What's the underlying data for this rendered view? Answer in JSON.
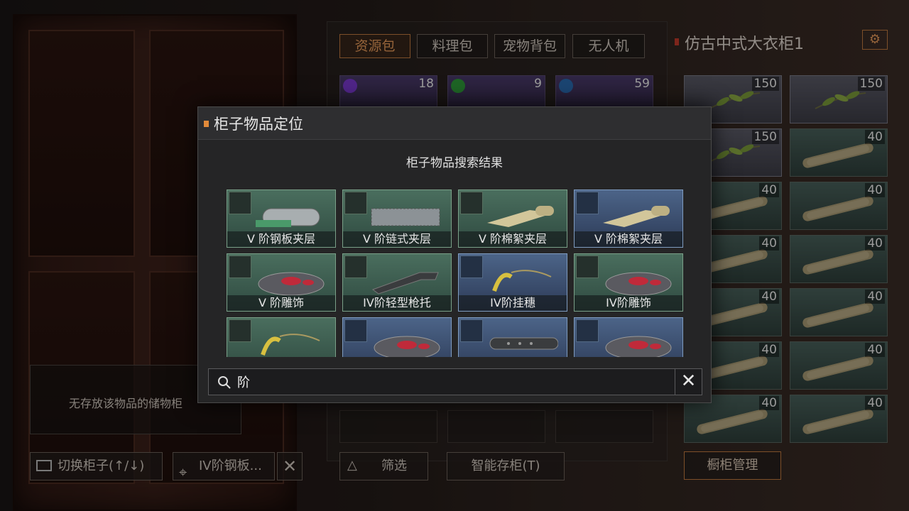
{
  "storage_tabs": [
    {
      "label": "资源包",
      "active": true
    },
    {
      "label": "料理包",
      "active": false
    },
    {
      "label": "宠物背包",
      "active": false
    },
    {
      "label": "无人机",
      "active": false
    }
  ],
  "bag_items": [
    {
      "count": "18",
      "badge_color": "#7a3ad0"
    },
    {
      "count": "9",
      "badge_color": "#2e9a3a"
    },
    {
      "count": "59",
      "badge_color": "#2a6ab0"
    }
  ],
  "cabinet": {
    "title": "仿古中式大衣柜1",
    "gear_icon": "gear-icon",
    "slots": [
      {
        "count": "150",
        "type": "leaf"
      },
      {
        "count": "150",
        "type": "leaf"
      },
      {
        "count": "150",
        "type": "leaf"
      },
      {
        "count": "40",
        "type": "bone"
      },
      {
        "count": "40",
        "type": "bone"
      },
      {
        "count": "40",
        "type": "bone"
      },
      {
        "count": "40",
        "type": "bone"
      },
      {
        "count": "40",
        "type": "bone"
      },
      {
        "count": "40",
        "type": "bone"
      },
      {
        "count": "40",
        "type": "bone"
      },
      {
        "count": "40",
        "type": "bone"
      },
      {
        "count": "40",
        "type": "bone"
      },
      {
        "count": "40",
        "type": "bone"
      },
      {
        "count": "40",
        "type": "bone"
      }
    ],
    "manage_label": "橱柜管理"
  },
  "info_text": "无存放该物品的储物柜",
  "bottom_buttons": {
    "switch_label": "切换柜子(↑/↓)",
    "locate_label": "IV阶钢板...",
    "filter_label": "筛选",
    "smart_store_label": "智能存柜(T)"
  },
  "modal": {
    "title": "柜子物品定位",
    "subtitle": "柜子物品搜索结果",
    "results": [
      {
        "label": "V 阶钢板夹层",
        "tier": "green",
        "icon": "armor-plate-icon"
      },
      {
        "label": "V 阶链式夹层",
        "tier": "green",
        "icon": "chain-mail-icon"
      },
      {
        "label": "V 阶棉絮夹层",
        "tier": "green",
        "icon": "cloth-roll-icon"
      },
      {
        "label": "V 阶棉絮夹层",
        "tier": "blue",
        "icon": "cloth-roll-icon"
      },
      {
        "label": "V 阶雕饰",
        "tier": "green",
        "icon": "ornament-icon"
      },
      {
        "label": "IV阶轻型枪托",
        "tier": "green",
        "icon": "gun-stock-icon"
      },
      {
        "label": "IV阶挂穗",
        "tier": "blue",
        "icon": "tassel-icon"
      },
      {
        "label": "IV阶雕饰",
        "tier": "green",
        "icon": "ornament-icon"
      },
      {
        "label": "",
        "tier": "green",
        "icon": "tassel-icon"
      },
      {
        "label": "",
        "tier": "blue",
        "icon": "ornament-icon"
      },
      {
        "label": "",
        "tier": "blue",
        "icon": "suppressor-icon"
      },
      {
        "label": "",
        "tier": "blue",
        "icon": "ornament-icon"
      }
    ],
    "search_value": "阶",
    "search_placeholder": ""
  }
}
